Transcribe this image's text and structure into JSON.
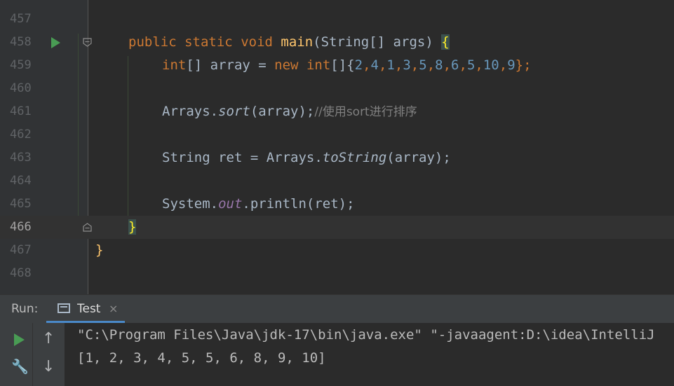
{
  "editor": {
    "lines": [
      {
        "num": "457"
      },
      {
        "num": "458"
      },
      {
        "num": "459"
      },
      {
        "num": "460"
      },
      {
        "num": "461"
      },
      {
        "num": "462"
      },
      {
        "num": "463"
      },
      {
        "num": "464"
      },
      {
        "num": "465"
      },
      {
        "num": "466"
      },
      {
        "num": "467"
      },
      {
        "num": "468"
      }
    ],
    "tokens": {
      "l458": [
        "public",
        "static",
        "void",
        "main",
        "(String[] args) ",
        "{"
      ],
      "l459": [
        "int",
        "[] array = ",
        "new",
        "int",
        "[]{",
        "2",
        ",",
        "4",
        ",",
        "1",
        ",",
        "3",
        ",",
        "5",
        ",",
        "8",
        ",",
        "6",
        ",",
        "5",
        ",",
        "10",
        ",",
        "9",
        "};"
      ],
      "l461": [
        "Arrays.",
        "sort",
        "(array);",
        "//使用sort进行排序"
      ],
      "l463": [
        "String ret = Arrays.",
        "toString",
        "(array);"
      ],
      "l465": [
        "System.",
        "out",
        ".println(ret);"
      ],
      "l466": [
        "}"
      ],
      "l467": [
        "}"
      ]
    }
  },
  "run_panel": {
    "label": "Run:",
    "tab_label": "Test",
    "tab_close": "×",
    "icons": [
      "run-icon",
      "wrench-icon",
      "up-arrow-icon",
      "down-arrow-icon",
      "console-icon",
      "close-icon"
    ],
    "output": [
      "\"C:\\Program Files\\Java\\jdk-17\\bin\\java.exe\" \"-javaagent:D:\\idea\\IntelliJ",
      "[1, 2, 3, 4, 5, 5, 6, 8, 9, 10]"
    ]
  },
  "colors": {
    "keyword": "#cc7832",
    "method_decl": "#ffc66d",
    "number": "#6897bb",
    "comment": "#808080",
    "field": "#9876aa",
    "run_green": "#499c54"
  }
}
